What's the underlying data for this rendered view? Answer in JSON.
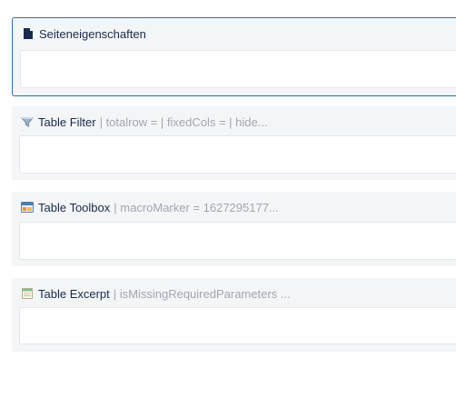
{
  "macros": [
    {
      "title": "Seiteneigenschaften",
      "params": "",
      "icon": "page-icon",
      "selected": true
    },
    {
      "title": "Table Filter",
      "params": "| totalrow = | fixedCols = | hide...",
      "icon": "filter-icon",
      "selected": false
    },
    {
      "title": "Table Toolbox",
      "params": "| macroMarker = 1627295177...",
      "icon": "toolbox-icon",
      "selected": false
    },
    {
      "title": "Table Excerpt",
      "params": "| isMissingRequiredParameters ...",
      "icon": "excerpt-icon",
      "selected": false
    }
  ],
  "colors": {
    "selection_border": "#2f6fb2",
    "macro_background": "#f4f5f7",
    "param_text": "#a0a6b0"
  }
}
